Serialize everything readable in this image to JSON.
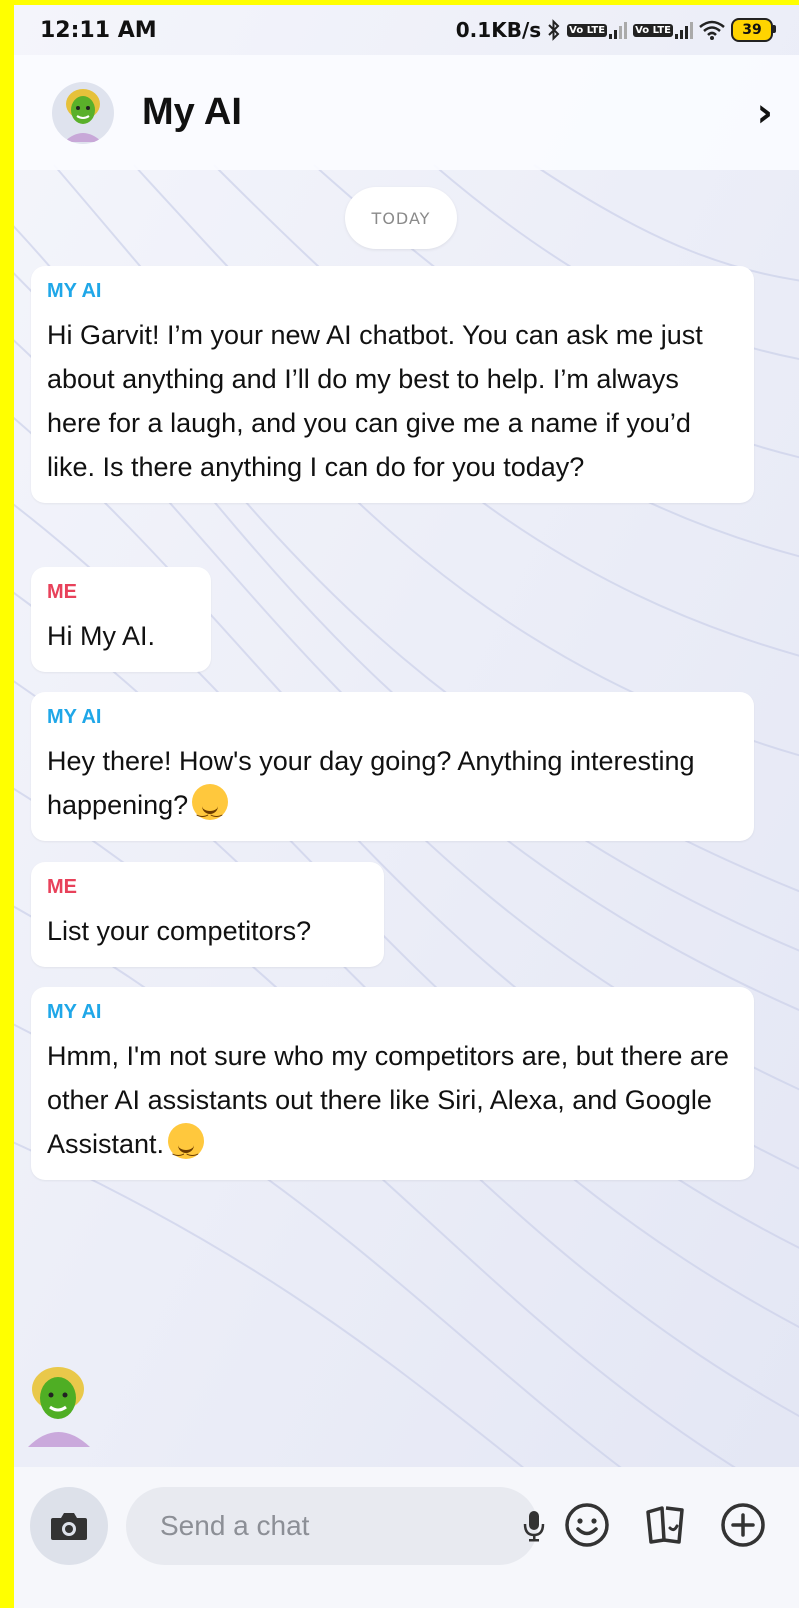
{
  "status_bar": {
    "time": "12:11 AM",
    "network_speed": "0.1KB/s",
    "sim1_label": "Vo LTE",
    "sim2_label": "Vo LTE",
    "battery": "39",
    "icons": [
      "bluetooth-icon",
      "signal-icon",
      "signal-icon",
      "wifi-icon",
      "battery-icon"
    ]
  },
  "header": {
    "title": "My AI",
    "chevron": "›",
    "icons": [
      "bitmoji-avatar",
      "chevron-right-icon"
    ]
  },
  "chat": {
    "day_label": "TODAY",
    "messages": [
      {
        "sender": "MY AI",
        "role": "ai",
        "text": "Hi Garvit! I’m your new AI chatbot. You can ask me just about anything and I’ll do my best to help. I’m always here for a laugh, and you can give me a name if you’d like. Is there anything I can do for you today?"
      },
      {
        "sender": "ME",
        "role": "me",
        "text": "Hi My AI."
      },
      {
        "sender": "MY AI",
        "role": "ai",
        "text": "Hey there! How's your day going? Anything interesting happening?",
        "emoji": "smiling-face-emoji"
      },
      {
        "sender": "ME",
        "role": "me",
        "text": "List your competitors?"
      },
      {
        "sender": "MY AI",
        "role": "ai",
        "text": "Hmm, I'm not sure who my competitors are, but there are other AI assistants out there like Siri, Alexa, and Google Assistant.",
        "emoji": "smiling-face-emoji"
      }
    ]
  },
  "composer": {
    "placeholder": "Send a chat",
    "value": "",
    "icons": [
      "camera-icon",
      "microphone-icon",
      "emoji-icon",
      "stickers-icon",
      "plus-icon"
    ]
  },
  "colors": {
    "ai_sender": "#1fa7e8",
    "me_sender": "#e8415a",
    "frame": "#ffff00",
    "battery": "#ffd400"
  }
}
